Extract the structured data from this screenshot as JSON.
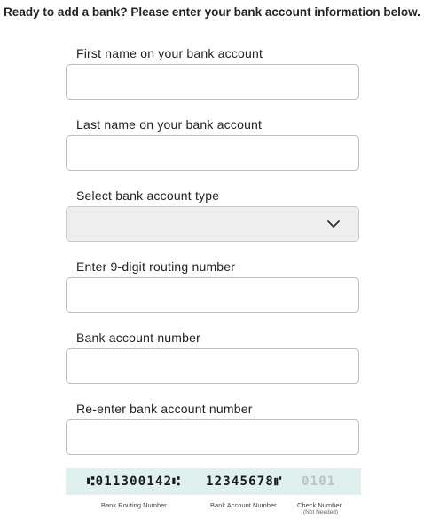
{
  "header": {
    "title": "Ready to add a bank? Please enter your bank account information below."
  },
  "form": {
    "first_name": {
      "label": "First name on your bank account",
      "value": "",
      "placeholder": ""
    },
    "last_name": {
      "label": "Last name on your bank account",
      "value": "",
      "placeholder": ""
    },
    "account_type": {
      "label": "Select bank account type",
      "selected": ""
    },
    "routing_number": {
      "label": "Enter 9-digit routing number",
      "value": "",
      "placeholder": ""
    },
    "account_number": {
      "label": "Bank account number",
      "value": "",
      "placeholder": ""
    },
    "account_number_confirm": {
      "label": "Re-enter bank account number",
      "value": "",
      "placeholder": ""
    }
  },
  "check_diagram": {
    "routing_digits": "⑆011300142⑆",
    "account_digits": "12345678⑈",
    "check_digits": "0101",
    "routing_caption": "Bank Routing Number",
    "account_caption": "Bank Account Number",
    "check_caption": "Check Number",
    "check_subcaption": "(Not Needed)",
    "background_color": "#dff0ef"
  },
  "icons": {
    "select_chevron": "chevron-down-icon"
  }
}
